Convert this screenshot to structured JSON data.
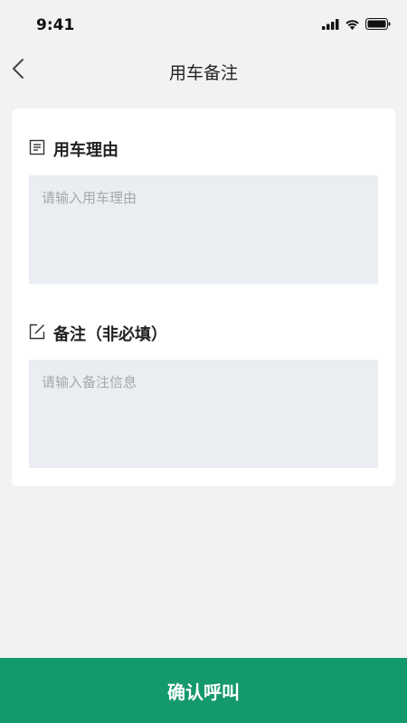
{
  "status_bar": {
    "time": "9:41",
    "icons": [
      "cellular-signal-icon",
      "wifi-icon",
      "battery-icon"
    ]
  },
  "nav": {
    "title": "用车备注",
    "back_icon": "chevron-left-icon"
  },
  "reason_section": {
    "icon": "document-lines-icon",
    "label": "用车理由",
    "placeholder": "请输入用车理由",
    "value": ""
  },
  "note_section": {
    "icon": "edit-icon",
    "label": "备注（非必填）",
    "placeholder": "请输入备注信息",
    "value": ""
  },
  "footer": {
    "confirm_label": "确认呼叫"
  },
  "colors": {
    "accent": "#14996b",
    "background": "#f2f2f2",
    "input_background": "#eaeef2",
    "placeholder": "#a3a8ad"
  }
}
